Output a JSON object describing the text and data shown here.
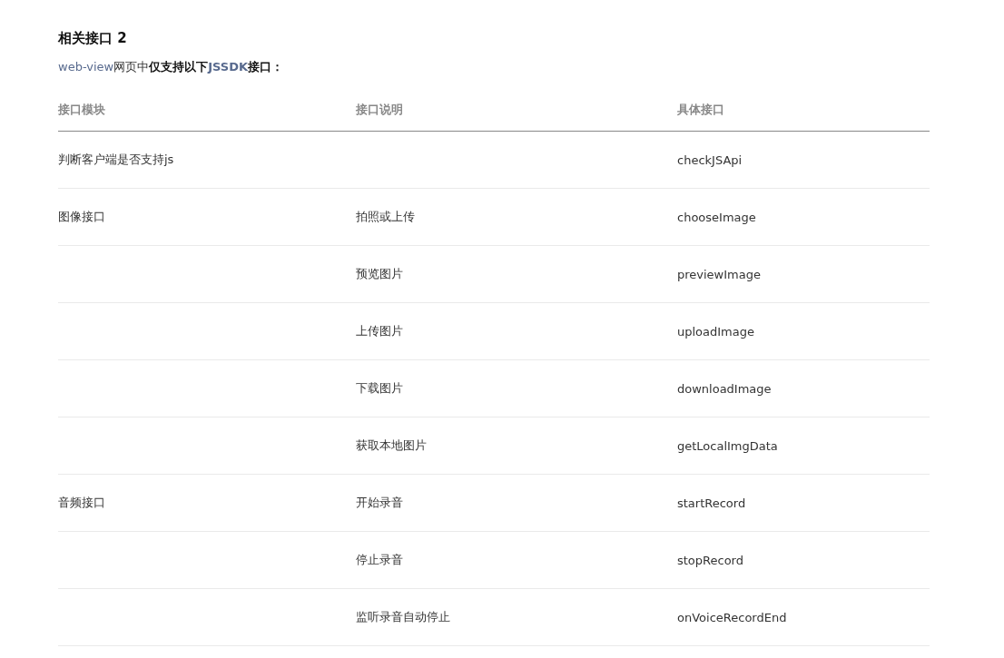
{
  "heading": "相关接口 2",
  "intro": [
    {
      "text": "web-view",
      "kind": "code"
    },
    {
      "text": "网页中",
      "kind": "plain"
    },
    {
      "text": "仅支持以下",
      "kind": "bold"
    },
    {
      "text": "JSSDK",
      "kind": "bold-code"
    },
    {
      "text": "接口：",
      "kind": "bold"
    }
  ],
  "table": {
    "columns": [
      "接口模块",
      "接口说明",
      "具体接口"
    ],
    "rows": [
      [
        "判断客户端是否支持js",
        "",
        "checkJSApi"
      ],
      [
        "图像接口",
        "拍照或上传",
        "chooseImage"
      ],
      [
        "",
        "预览图片",
        "previewImage"
      ],
      [
        "",
        "上传图片",
        "uploadImage"
      ],
      [
        "",
        "下载图片",
        "downloadImage"
      ],
      [
        "",
        "获取本地图片",
        "getLocalImgData"
      ],
      [
        "音频接口",
        "开始录音",
        "startRecord"
      ],
      [
        "",
        "停止录音",
        "stopRecord"
      ],
      [
        "",
        "监听录音自动停止",
        "onVoiceRecordEnd"
      ]
    ]
  }
}
